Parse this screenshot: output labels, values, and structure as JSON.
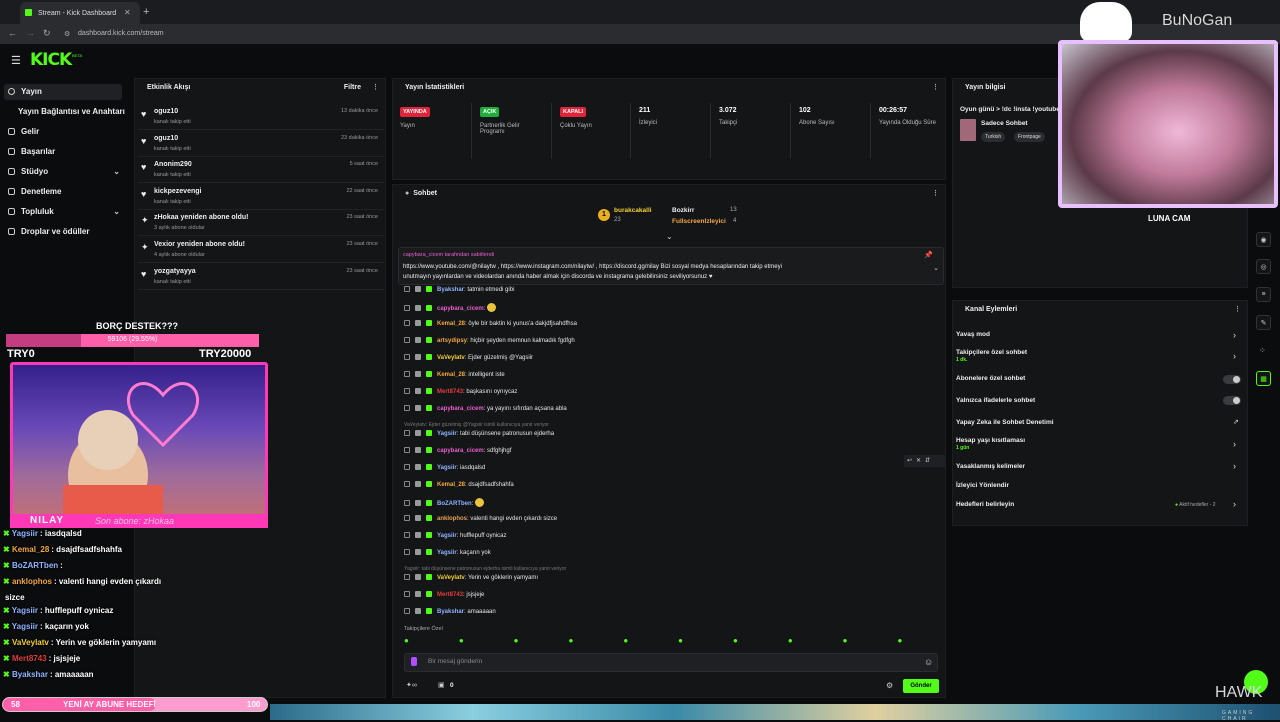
{
  "browser": {
    "tab_title": "Stream - Kick Dashboard",
    "url": "dashboard.kick.com/stream",
    "new_tab": "+",
    "close": "✕"
  },
  "app": {
    "logo": "KICK",
    "logo_badge": "BETA"
  },
  "sidebar": {
    "items": [
      {
        "label": "Yayın",
        "icon": "broadcast-icon"
      },
      {
        "label": "Yayın Bağlantısı ve Anahtarı",
        "icon": ""
      },
      {
        "label": "Gelir",
        "icon": "money-icon"
      },
      {
        "label": "Başarılar",
        "icon": "trophy-icon"
      },
      {
        "label": "Stüdyo",
        "icon": "studio-icon"
      },
      {
        "label": "Denetleme",
        "icon": "shield-icon"
      },
      {
        "label": "Topluluk",
        "icon": "community-icon"
      },
      {
        "label": "Droplar ve ödüller",
        "icon": "gift-icon"
      }
    ]
  },
  "activity": {
    "title": "Etkinlik Akışı",
    "filter": "Filtre",
    "items": [
      {
        "name": "oguz10",
        "sub": "kanalı takip etti",
        "time": "13 dakika önce"
      },
      {
        "name": "oguz10",
        "sub": "kanalı takip etti",
        "time": "23 dakika önce"
      },
      {
        "name": "Anonim290",
        "sub": "kanalı takip etti",
        "time": "5 saat önce"
      },
      {
        "name": "kickpezevengi",
        "sub": "kanalı takip etti",
        "time": "22 saat önce"
      },
      {
        "name": "zHokaa yeniden abone oldu!",
        "sub": "3 aylık abone oldular",
        "time": "23 saat önce"
      },
      {
        "name": "Vexior yeniden abone oldu!",
        "sub": "4 aylık abone oldular",
        "time": "23 saat önce"
      },
      {
        "name": "yozgatyayya",
        "sub": "kanalı takip etti",
        "time": "23 saat önce"
      }
    ]
  },
  "stats": {
    "title": "Yayın İstatistikleri",
    "cols": [
      {
        "badge": "YAYINDA",
        "badge_color": "#e0243a",
        "label": "Yayın"
      },
      {
        "badge": "AÇIK",
        "badge_color": "#1fae3a",
        "label": "Partnerlik Gelir Programı"
      },
      {
        "badge": "KAPALI",
        "badge_color": "#e0243a",
        "label": "Çoklu Yayın"
      },
      {
        "value": "211",
        "label": "İzleyici"
      },
      {
        "value": "3.072",
        "label": "Takipçi"
      },
      {
        "value": "102",
        "label": "Abone Sayısı"
      },
      {
        "value": "00:26:57",
        "label": "Yayında Olduğu Süre"
      }
    ]
  },
  "chat": {
    "title": "Sohbet",
    "leaders": [
      {
        "name": "burakcakalli",
        "count": "23"
      },
      {
        "name": "Bozkirr",
        "count": "13"
      },
      {
        "name": "FullscreenIzleyici",
        "count": "4"
      }
    ],
    "pinned_by": "capybara_cicem tarafından sabitlendi",
    "pinned_line1": "https://www.youtube.com/@nilaytw , https://www.instagram.com/nilaytw/ , https://discord.gg/nilay Bizi sosyal medya hesaplarından takip etmeyi",
    "pinned_line2": "unutmayın yayınlardan ve videolardan anında haber almak için discorda ve instagrama gelebilirsiniz seviliyorsunuz ♥",
    "messages": [
      {
        "user": "Byakshar",
        "color": "#8fb4ff",
        "text": "tatmin etmedi gibi"
      },
      {
        "user": "capybara_cicem",
        "color": "#e85fcf",
        "text": ""
      },
      {
        "user": "Kemal_28",
        "color": "#f4a640",
        "text": "öyle bir baktin ki yunus'a dakjdfjsahdfhsa"
      },
      {
        "user": "artsydipsy",
        "color": "#f4a640",
        "text": "hiçbir şeyden memnun kalmadık fgdfgh"
      },
      {
        "user": "VaVeylatv",
        "color": "#f4d030",
        "text": "Ejder güzelmiş @Yagsiir"
      },
      {
        "user": "Kemal_28",
        "color": "#f4a640",
        "text": "intelligent iste"
      },
      {
        "user": "Mert8743",
        "color": "#e23c3c",
        "text": "başkasını oynıycaz"
      },
      {
        "user": "capybara_cicem",
        "color": "#e85fcf",
        "text": "ya yayını sıfırdan açsana abla"
      },
      {
        "reply": "VaVeylatv: Ejder güzelmiş @Yagsiir isimli kullanıcıya yanıt veriyor"
      },
      {
        "user": "Yagsiir",
        "color": "#8fb4ff",
        "text": "tabi düşünsene patronusun ejderha"
      },
      {
        "user": "capybara_cicem",
        "color": "#e85fcf",
        "text": "sdfghjhgf"
      },
      {
        "user": "Yagsiir",
        "color": "#8fb4ff",
        "text": "iasdqalsd"
      },
      {
        "user": "Kemal_28",
        "color": "#f4a640",
        "text": "dsajdfsadfshahfa"
      },
      {
        "user": "BoZARTben",
        "color": "#8fb4ff",
        "text": ""
      },
      {
        "user": "anklophos",
        "color": "#e8a050",
        "text": "valenti hangi evden çıkardı sizce"
      },
      {
        "user": "Yagsiir",
        "color": "#8fb4ff",
        "text": "hufflepuff oynicaz"
      },
      {
        "user": "Yagsiir",
        "color": "#8fb4ff",
        "text": "kaçarın yok"
      },
      {
        "reply": "Yagsiir: tabi düşünsene patronusun ejderha isimli kullanıcıya yanıt veriyor"
      },
      {
        "user": "VaVeylatv",
        "color": "#f4d030",
        "text": "Yerin ve göklerin yamyamı"
      },
      {
        "user": "Mert8743",
        "color": "#e23c3c",
        "text": "jsjsjeje"
      },
      {
        "user": "Byakshar",
        "color": "#8fb4ff",
        "text": "amaaaaan"
      }
    ],
    "followers_only": "Takipçilere Özel",
    "input_placeholder": "Bir mesaj gönderin",
    "send": "Gönder",
    "points": "0"
  },
  "info": {
    "title": "Yayın bilgisi",
    "stream_title": "Oyun günü > !dc !insta !youtube",
    "category": "Sadece Sohbet",
    "tags": [
      "Turkish",
      "Frontpage"
    ]
  },
  "actions": {
    "title": "Kanal Eylemleri",
    "rows": [
      {
        "label": "Yavaş mod",
        "kind": "chev"
      },
      {
        "label": "Takipçilere özel sohbet",
        "sub": "1 dk.",
        "kind": "chev"
      },
      {
        "label": "Abonelere özel sohbet",
        "kind": "toggle"
      },
      {
        "label": "Yalnızca ifadelerle sohbet",
        "kind": "toggle"
      },
      {
        "label": "Yapay Zeka ile Sohbet Denetimi",
        "kind": "link"
      },
      {
        "label": "Hesap yaşı kısıtlaması",
        "sub": "1 gün",
        "kind": "chev"
      },
      {
        "label": "Yasaklanmış kelimeler",
        "kind": "chev"
      },
      {
        "label": "İzleyici Yönlendir",
        "kind": "none"
      },
      {
        "label": "Hedefleri belirleyin",
        "kind": "chev",
        "right": "Aktif hedefler - 2"
      }
    ]
  },
  "overlay": {
    "goal_title": "BORÇ DESTEK???",
    "goal_bar": "59106 (29.55%)",
    "goal_progress": 0.2955,
    "goal_min": "TRY0",
    "goal_max": "TRY20000",
    "streamer": "NILAY",
    "last_sub": "Son abone: zHokaa",
    "chat": [
      {
        "user": "Yagsiir",
        "color": "#8fb4ff",
        "text": ": iasdqalsd"
      },
      {
        "user": "Kemal_28",
        "color": "#f4a640",
        "text": ": dsajdfsadfshahfa"
      },
      {
        "user": "BoZARTben",
        "color": "#8fb4ff",
        "text": ":"
      },
      {
        "user": "anklophos",
        "color": "#f4a640",
        "text": ": valenti hangi evden çıkardı"
      },
      {
        "user": "",
        "color": "#fff",
        "text": "sizce"
      },
      {
        "user": "Yagsiir",
        "color": "#8fb4ff",
        "text": ": hufflepuff oynicaz"
      },
      {
        "user": "Yagsiir",
        "color": "#8fb4ff",
        "text": ": kaçarın yok"
      },
      {
        "user": "VaVeylatv",
        "color": "#f4d030",
        "text": ": Yerin ve göklerin yamyamı"
      },
      {
        "user": "Mert8743",
        "color": "#e23c3c",
        "text": ": jsjsjeje"
      },
      {
        "user": "Byakshar",
        "color": "#8fb4ff",
        "text": ": amaaaaan"
      }
    ],
    "sub_goal_left": "58",
    "sub_goal_label": "YENİ AY ABUNE HEDEFİ",
    "sub_goal_right": "100",
    "sub_goal_progress": 0.58,
    "cat_brand": "BuNoGan",
    "cat_cam_label": "LUNA CAM",
    "sponsor": "HAWK",
    "sponsor_sub": "GAMING CHAIR"
  }
}
